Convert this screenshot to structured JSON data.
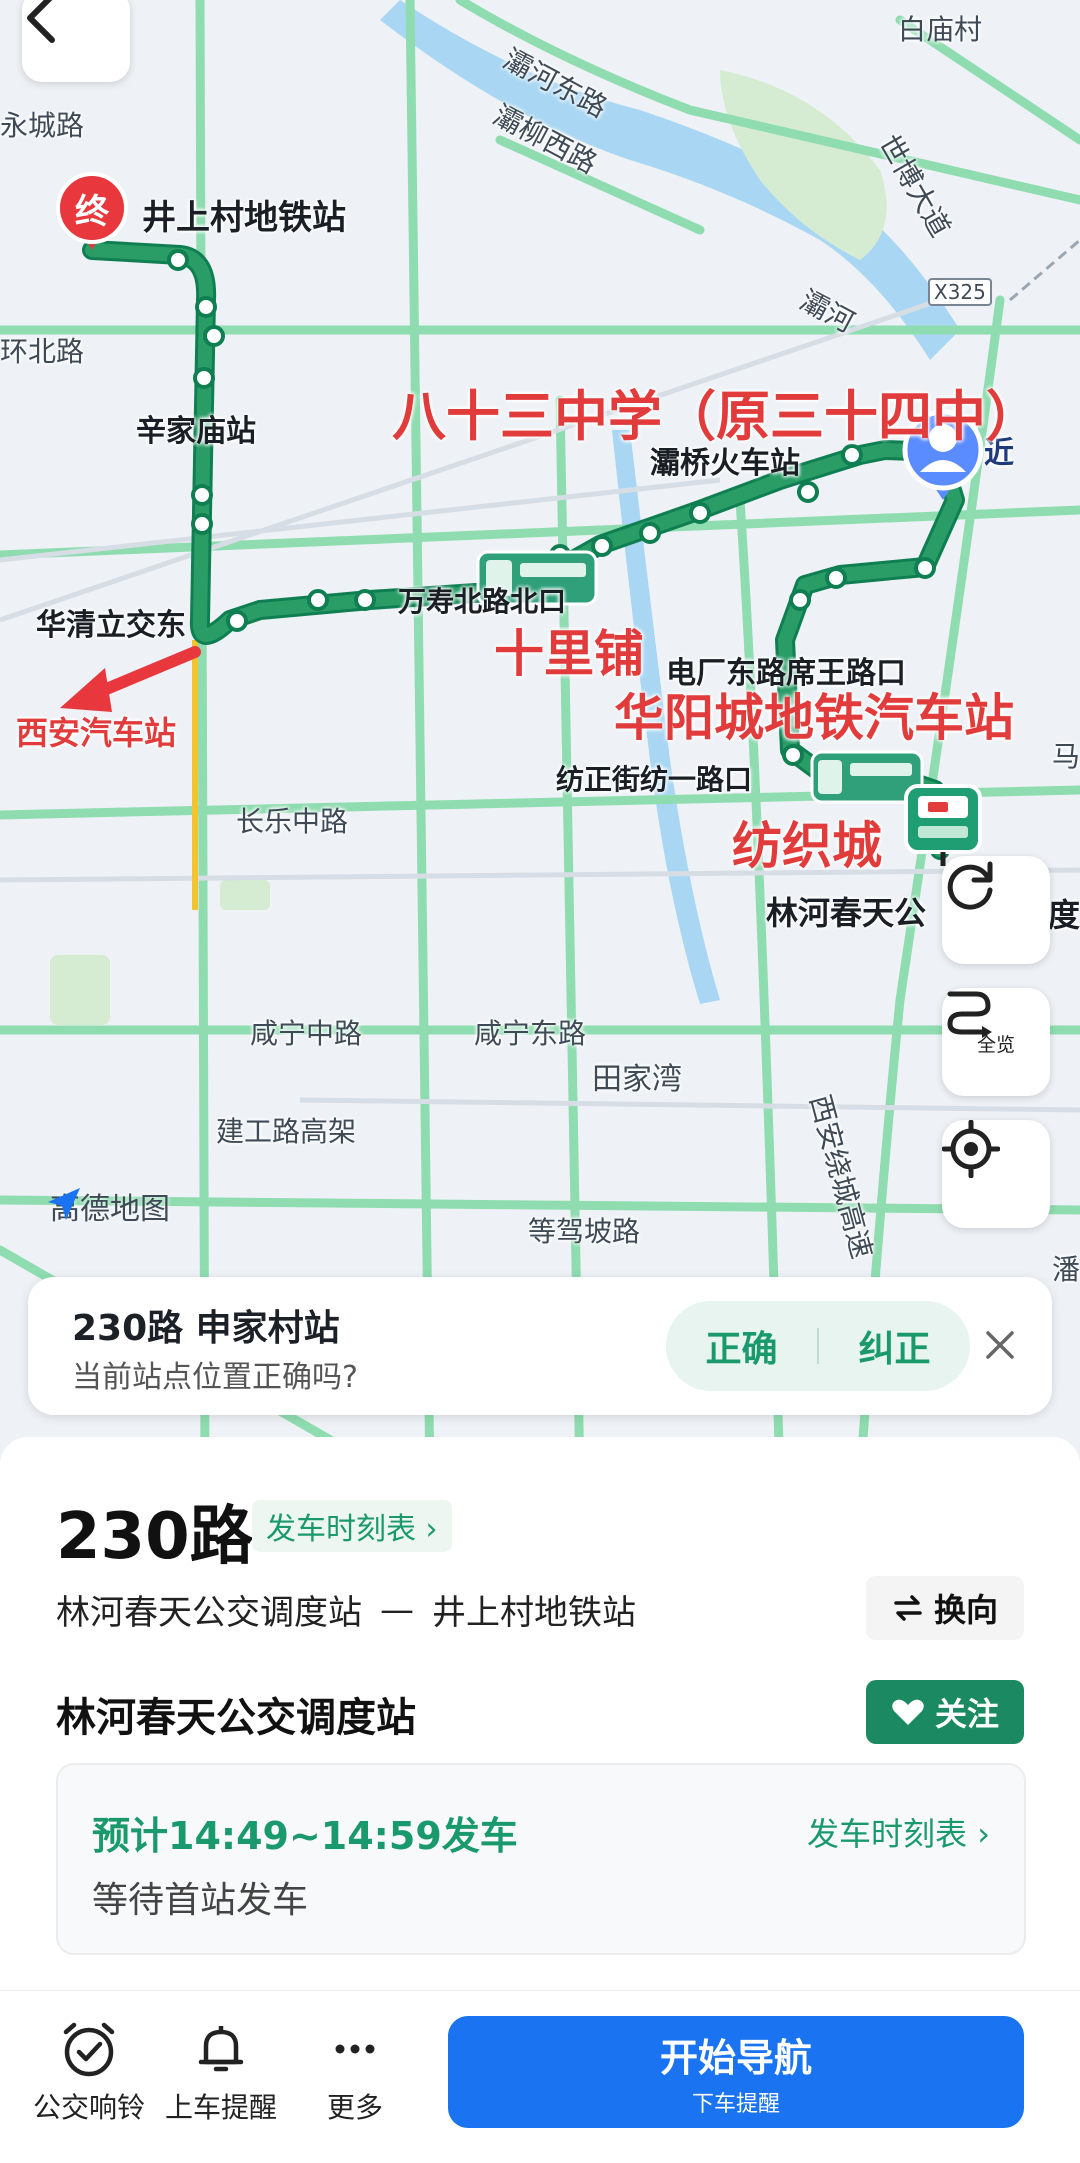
{
  "map": {
    "street_labels": [
      "白庙村",
      "灞河东路",
      "灞柳西路",
      "世博大道",
      "灞河",
      "X325",
      "永城路",
      "环北路",
      "长乐中路",
      "咸宁中路",
      "咸宁东路",
      "田家湾",
      "建工路高架",
      "等驾坡路",
      "西安绕城高速",
      "马",
      "度",
      "潘"
    ],
    "stops": {
      "terminal": "井上村地铁站",
      "xinjiamiao": "辛家庙站",
      "huaqing": "华清立交东",
      "wanshou": "万寿北路北口",
      "bachiao": "灞桥火车站",
      "dianchang": "电厂东路席王路口",
      "fangzheng": "纺正街纺一路口",
      "linhe": "林河春天公"
    },
    "terminal_marker": "终",
    "near_tag": "近",
    "brand": "高德地图"
  },
  "annotations": {
    "school": "八十三中学（原三十四中）",
    "shilipu": "十里铺",
    "huayang": "华阳城地铁汽车站",
    "fangzhicheng": "纺织城",
    "xian_station": "西安汽车站"
  },
  "controls": {
    "overview_label": "全览"
  },
  "feedback": {
    "title": "230路 申家村站",
    "question": "当前站点位置正确吗?",
    "correct_label": "正确",
    "fix_label": "纠正"
  },
  "route": {
    "name": "230路",
    "timetable_label": "发车时刻表 ›",
    "from": "林河春天公交调度站",
    "arrow": "—",
    "to": "井上村地铁站",
    "swap_label": "换向"
  },
  "stop": {
    "name": "林河春天公交调度站",
    "follow_label": "关注",
    "estimate": "预计14:49~14:59发车",
    "timetable_link": "发车时刻表 ›",
    "status": "等待首站发车"
  },
  "bottom": {
    "items": [
      "公交响铃",
      "上车提醒",
      "更多"
    ],
    "nav_label": "开始导航",
    "nav_sub": "下车提醒"
  },
  "colors": {
    "route_green": "#2a9d67",
    "accent_green": "#1a9a6c",
    "nav_blue": "#1a73f0",
    "annotation_red": "#e23b3b"
  }
}
